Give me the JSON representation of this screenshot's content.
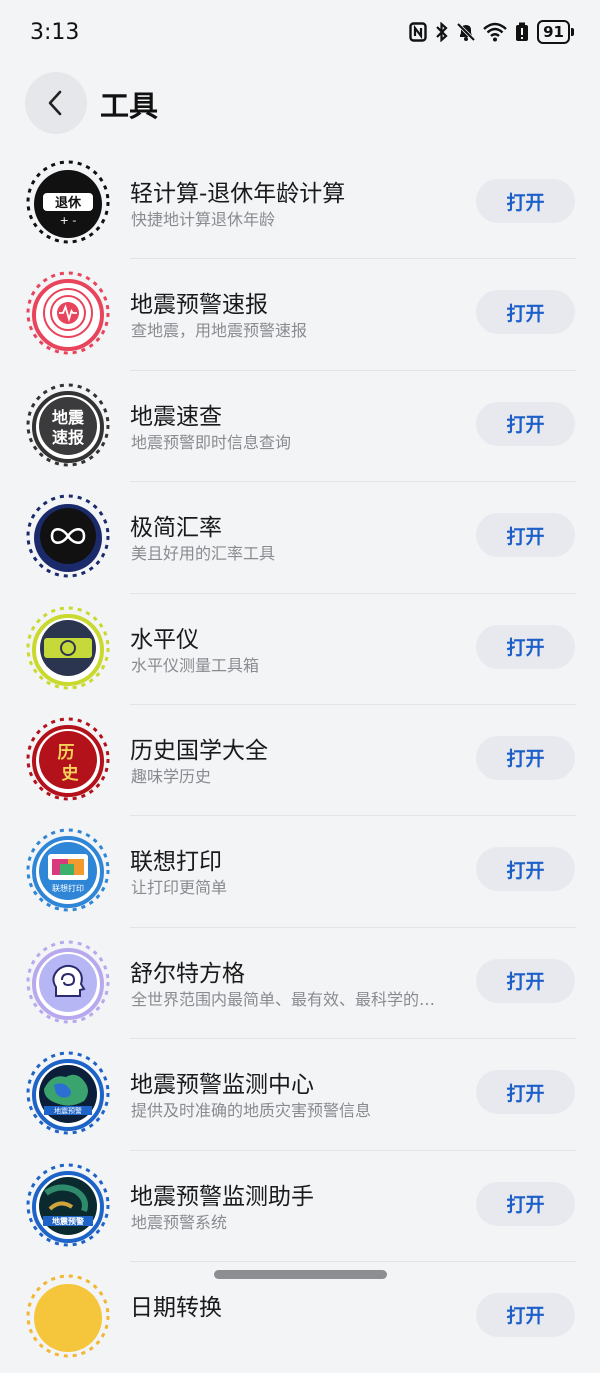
{
  "status": {
    "time": "3:13",
    "battery": "91"
  },
  "header": {
    "title": "工具"
  },
  "apps": [
    {
      "name": "轻计算-退休年龄计算",
      "desc": "快捷地计算退休年龄",
      "action": "打开",
      "icon": "retirement-calculator-icon",
      "icon_text": "退休"
    },
    {
      "name": "地震预警速报",
      "desc": "查地震，用地震预警速报",
      "action": "打开",
      "icon": "earthquake-alert-icon"
    },
    {
      "name": "地震速查",
      "desc": "地震预警即时信息查询",
      "action": "打开",
      "icon": "earthquake-lookup-icon",
      "icon_text_1": "地震",
      "icon_text_2": "速报"
    },
    {
      "name": "极简汇率",
      "desc": "美且好用的汇率工具",
      "action": "打开",
      "icon": "exchange-rate-icon"
    },
    {
      "name": "水平仪",
      "desc": "水平仪测量工具箱",
      "action": "打开",
      "icon": "spirit-level-icon"
    },
    {
      "name": "历史国学大全",
      "desc": "趣味学历史",
      "action": "打开",
      "icon": "history-icon",
      "icon_text_1": "历",
      "icon_text_2": "史"
    },
    {
      "name": "联想打印",
      "desc": "让打印更简单",
      "action": "打开",
      "icon": "printer-icon",
      "icon_text": "联想打印"
    },
    {
      "name": "舒尔特方格",
      "desc": "全世界范围内最简单、最有效、最科学的注意力训练方法",
      "action": "打开",
      "icon": "brain-icon"
    },
    {
      "name": "地震预警监测中心",
      "desc": "提供及时准确的地质灾害预警信息",
      "action": "打开",
      "icon": "earthquake-monitor-center-icon",
      "icon_text": "地震预警"
    },
    {
      "name": "地震预警监测助手",
      "desc": "地震预警系统",
      "action": "打开",
      "icon": "earthquake-monitor-assistant-icon",
      "icon_text": "地震预警"
    },
    {
      "name": "日期转换",
      "desc": "",
      "action": "打开",
      "icon": "date-convert-icon"
    }
  ]
}
